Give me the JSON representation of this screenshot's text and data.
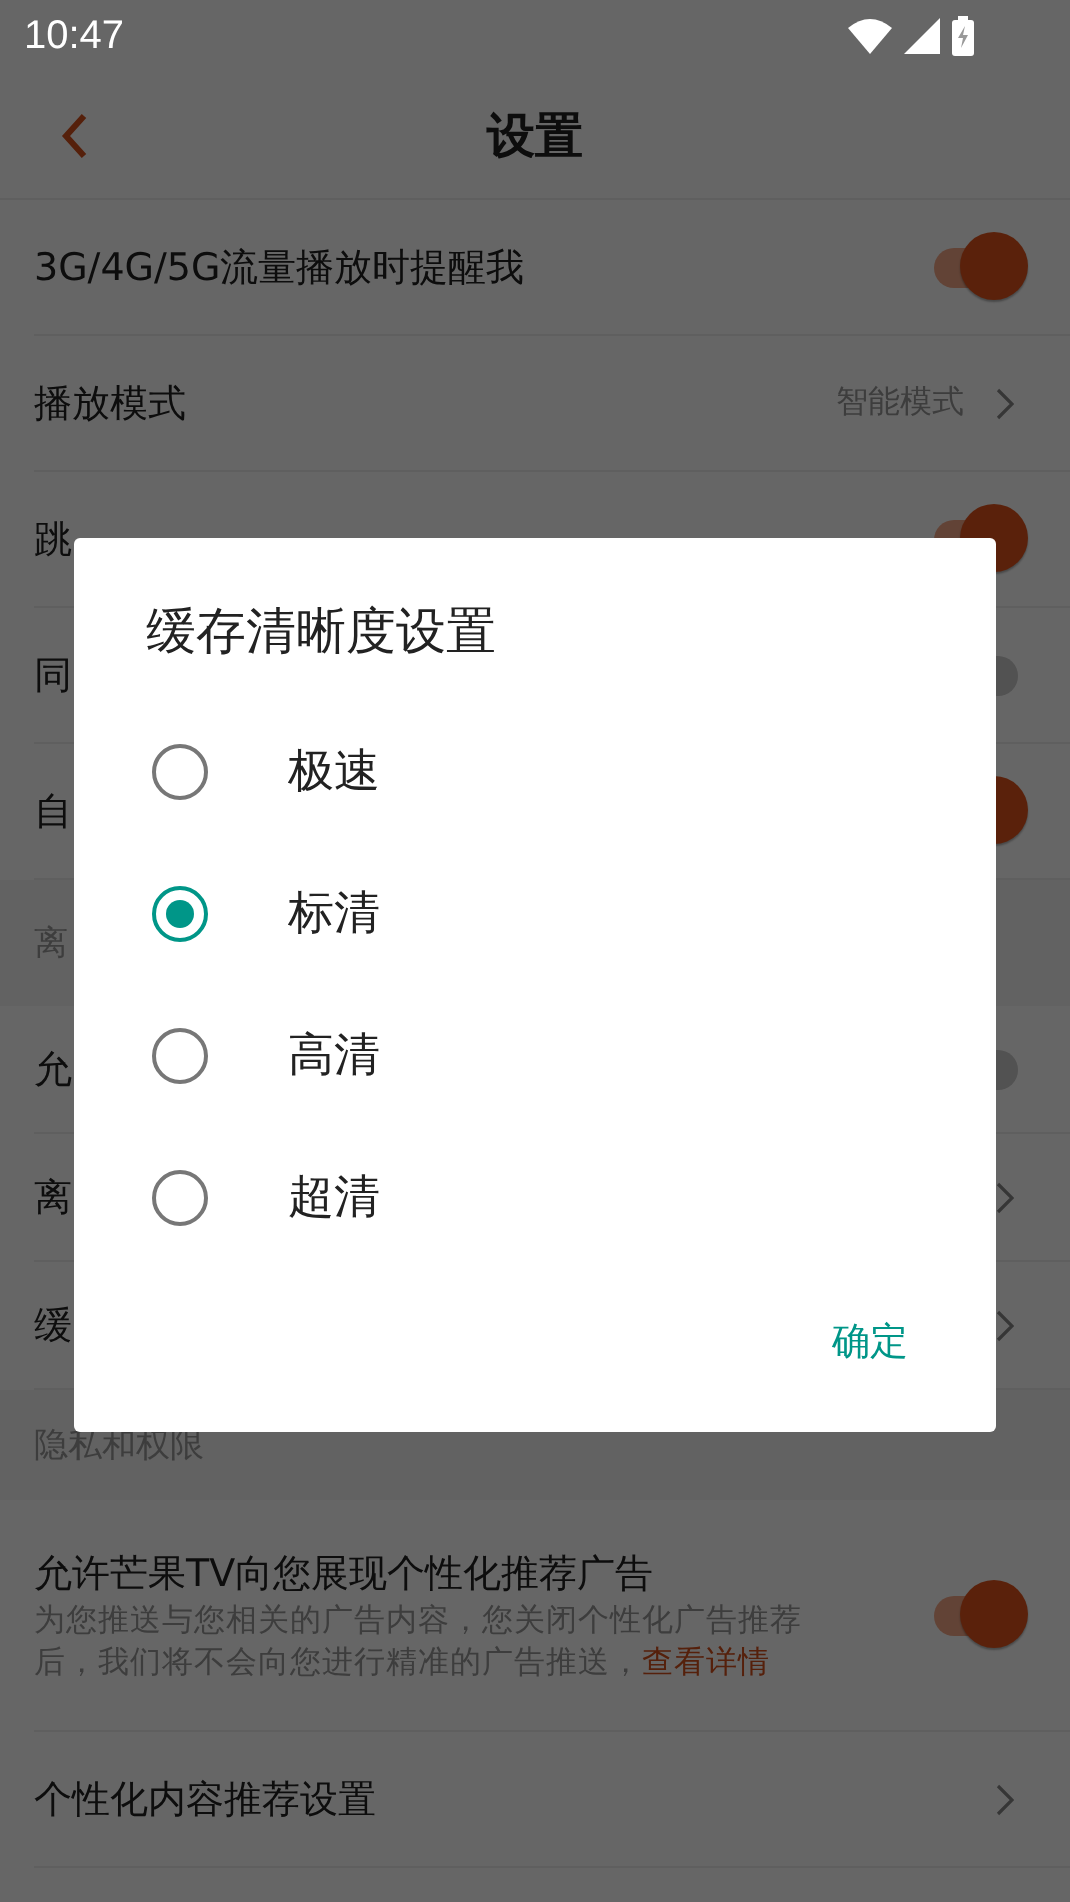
{
  "status_bar": {
    "time": "10:47"
  },
  "nav": {
    "title": "设置"
  },
  "settings": [
    {
      "kind": "toggle",
      "label": "3G/4G/5G流量播放时提醒我",
      "on": true
    },
    {
      "kind": "link",
      "label": "播放模式",
      "value": "智能模式"
    },
    {
      "kind": "toggle",
      "label": "跳",
      "on": true
    },
    {
      "kind": "toggle",
      "label": "同",
      "on": false
    },
    {
      "kind": "toggle",
      "label": "自",
      "on": true
    },
    {
      "kind": "section",
      "label": "离"
    },
    {
      "kind": "toggle",
      "label": "允",
      "on": false
    },
    {
      "kind": "link",
      "label": "离"
    },
    {
      "kind": "link",
      "label": "缓"
    },
    {
      "kind": "section",
      "label": "隐私和权限"
    },
    {
      "kind": "toggle",
      "label": "允许芒果TV向您展现个性化推荐广告",
      "description": "为您推送与您相关的广告内容，您关闭个性化广告推荐后，我们将不会向您进行精准的广告推送，",
      "link": "查看详情",
      "on": true
    },
    {
      "kind": "link",
      "label": "个性化内容推荐设置"
    }
  ],
  "dialog": {
    "title": "缓存清晰度设置",
    "options": [
      {
        "label": "极速",
        "selected": false
      },
      {
        "label": "标清",
        "selected": true
      },
      {
        "label": "高清",
        "selected": false
      },
      {
        "label": "超清",
        "selected": false
      }
    ],
    "confirm": "确定"
  }
}
